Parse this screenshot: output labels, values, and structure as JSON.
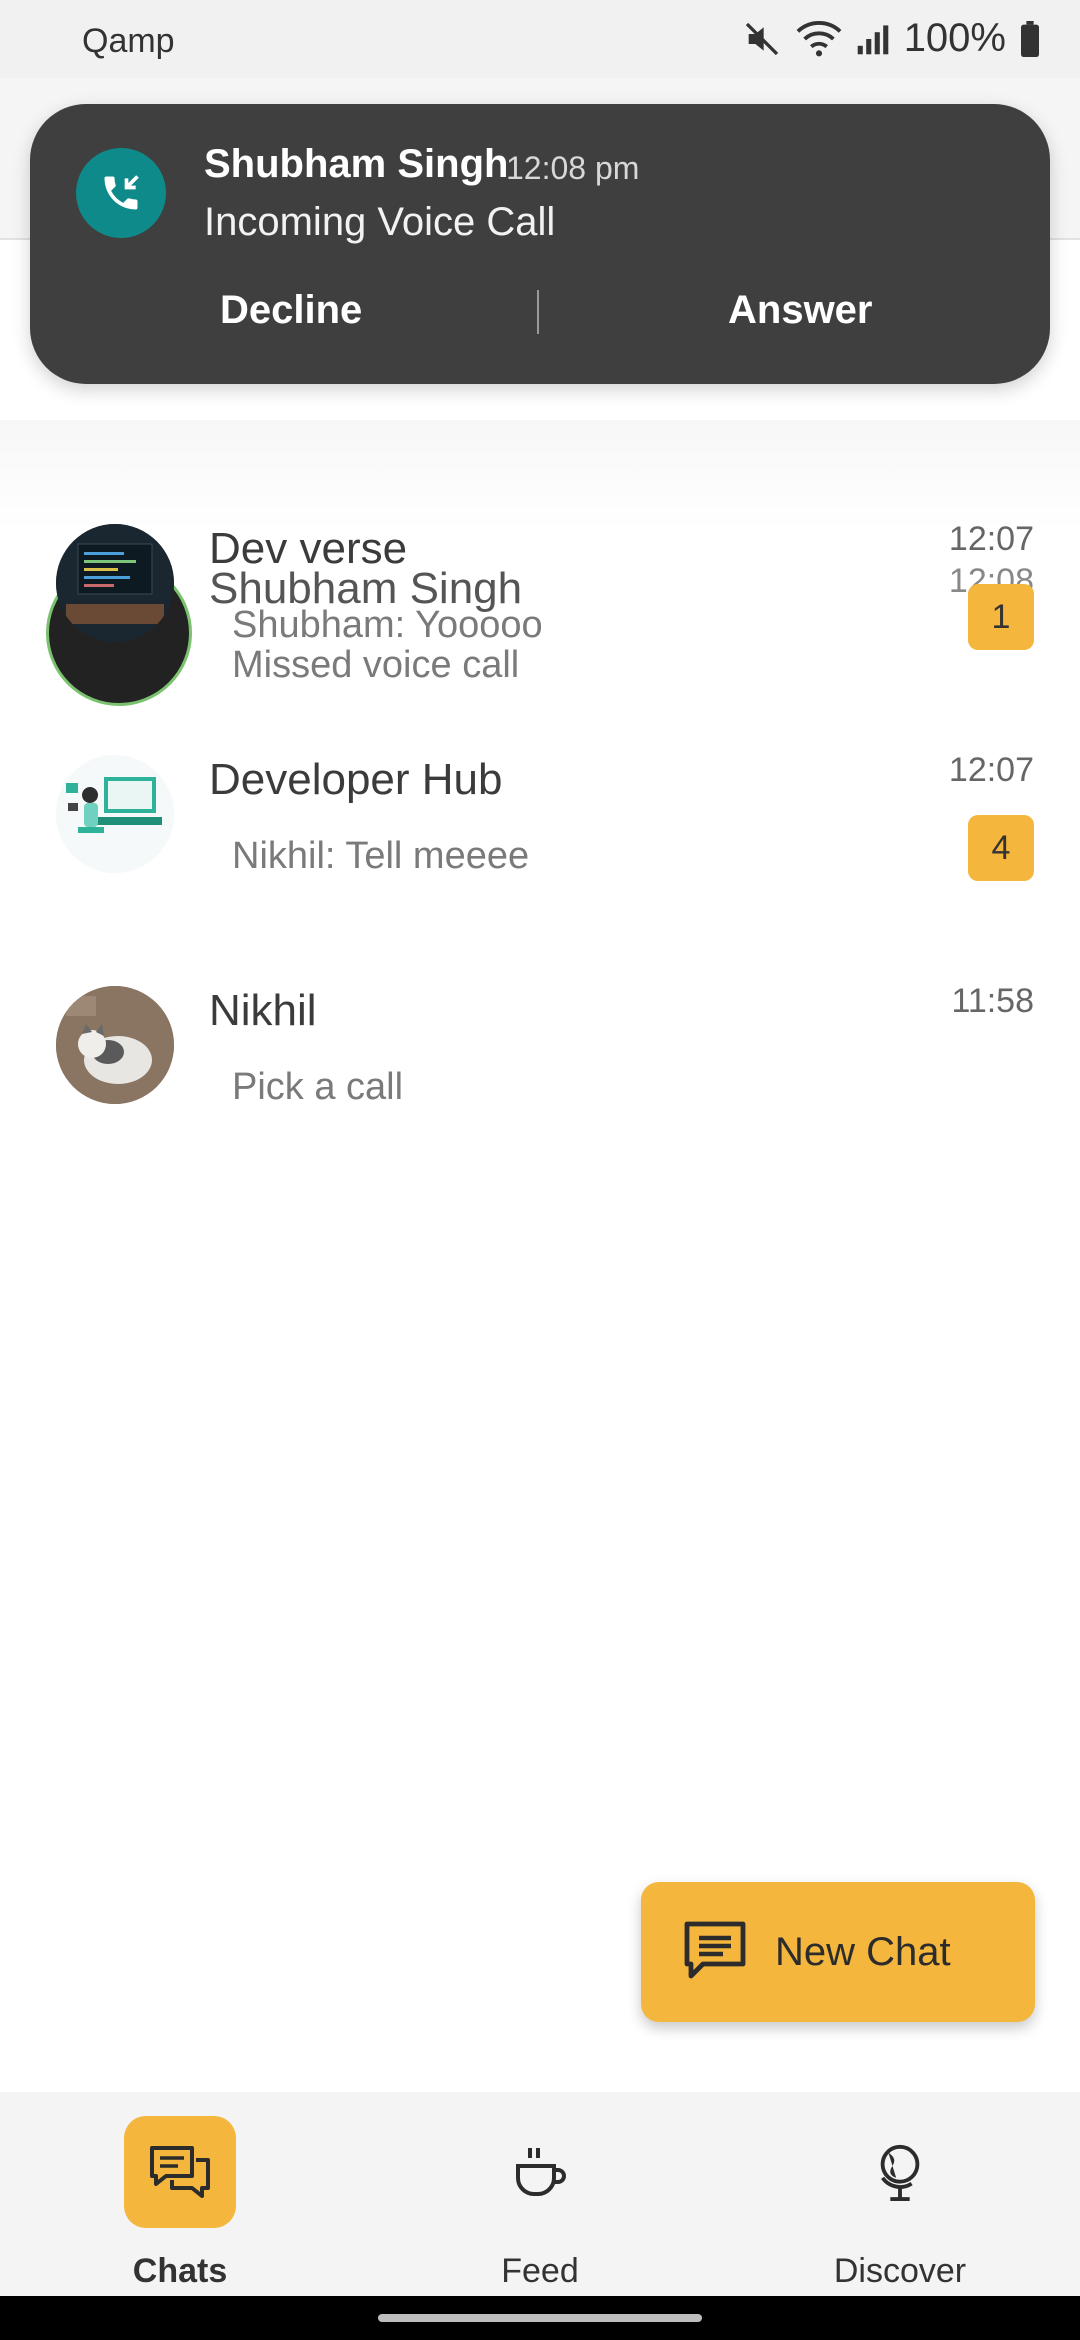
{
  "status_bar": {
    "app_name": "Qamp",
    "battery": "100%"
  },
  "notification": {
    "caller": "Shubham Singh",
    "time": "12:08 pm",
    "message": "Incoming Voice Call",
    "decline_label": "Decline",
    "answer_label": "Answer"
  },
  "chats": [
    {
      "name": "Shubham Singh",
      "preview": "Missed voice call",
      "time": "12:08"
    },
    {
      "name": "Dev verse",
      "preview": "Shubham: Yooooo",
      "time": "12:07",
      "unread": "1"
    },
    {
      "name": "Developer Hub",
      "preview": "Nikhil: Tell meeee",
      "time": "12:07",
      "unread": "4"
    },
    {
      "name": "Nikhil",
      "preview": "Pick a call",
      "time": "11:58"
    }
  ],
  "fab": {
    "label": "New Chat"
  },
  "bottom_nav": [
    {
      "label": "Chats",
      "icon": "chats-icon",
      "active": true
    },
    {
      "label": "Feed",
      "icon": "coffee-cup-icon",
      "active": false
    },
    {
      "label": "Discover",
      "icon": "globe-icon",
      "active": false
    }
  ],
  "colors": {
    "accent": "#f4b63c",
    "notification_bg": "#3f3f3f",
    "call_icon_bg": "#0f8a8a"
  }
}
